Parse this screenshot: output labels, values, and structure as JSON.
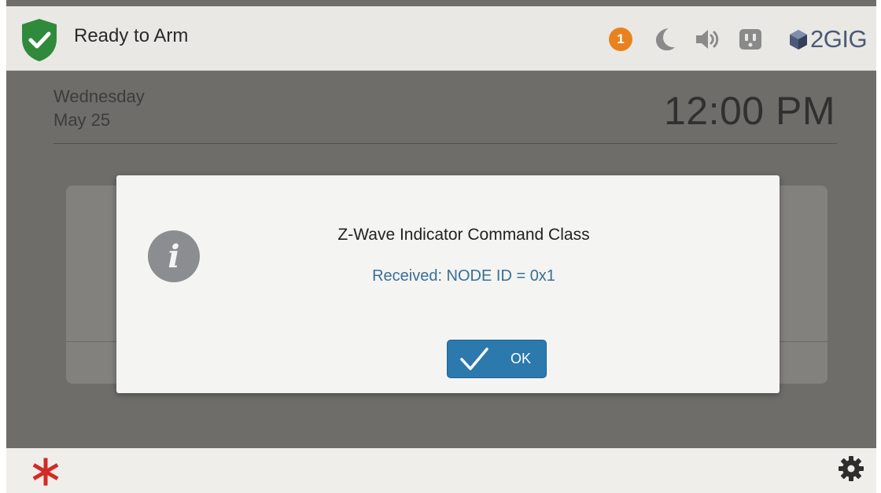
{
  "status_bar": {
    "status_text": "Ready to Arm",
    "alert_count": "1",
    "brand": "2GIG",
    "icons": [
      "shield-check-icon",
      "moon-icon",
      "speaker-icon",
      "outlet-icon",
      "brand-cube-icon"
    ]
  },
  "main": {
    "day": "Wednesday",
    "date": "May 25",
    "time": "12:00 PM"
  },
  "dialog": {
    "title": "Z-Wave Indicator Command Class",
    "message": "Received: NODE ID = 0x1",
    "ok_label": "OK",
    "icon": "info-icon"
  },
  "bottom_bar": {
    "icons": [
      "emergency-asterisk-icon",
      "gear-icon"
    ]
  },
  "colors": {
    "shield": "#2f8a3c",
    "alert_badge": "#e8821f",
    "accent": "#2b79ad",
    "message_text": "#3a6f95",
    "emergency": "#d22a25"
  }
}
